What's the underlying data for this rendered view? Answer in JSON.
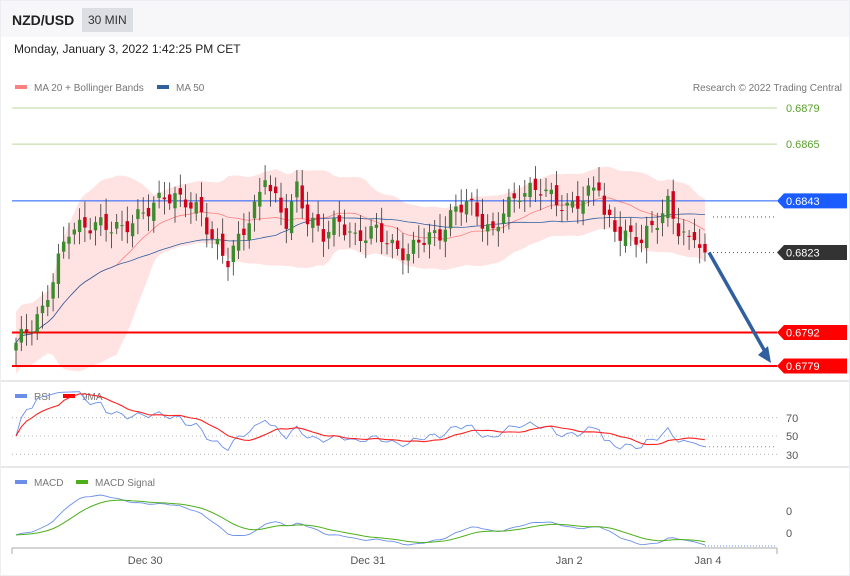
{
  "header": {
    "pair": "NZD/USD",
    "timeframe": "30 MIN",
    "datetime": "Monday, January 3, 2022 1:42:25 PM CET"
  },
  "copyright": "Research © 2022 Trading Central",
  "colors": {
    "up": "#3d8b2f",
    "down": "#d0021b",
    "ma20": "#ff8080",
    "ma50": "#2f5f9e",
    "band": "#ffe3e3",
    "resistance": "#7cb342",
    "pivot": "#1a5cff",
    "current": "#333333",
    "support": "#ff0000",
    "arrow": "#2f5f9e",
    "rsi": "#6b8fe8",
    "rsi_ma": "#ff2020",
    "macd": "#6b8fe8",
    "signal": "#4caf1a"
  },
  "chart_data": [
    {
      "type": "candlestick",
      "title": "NZD/USD 30 MIN",
      "legend": [
        "MA 20 + Bollinger Bands",
        "MA 50"
      ],
      "ylim": [
        0.6779,
        0.6879
      ],
      "x_ticks": [
        {
          "label": "Dec 30",
          "index": 24
        },
        {
          "label": "Dec 31",
          "index": 66
        },
        {
          "label": "Jan 2",
          "index": 104
        },
        {
          "label": "Jan 4",
          "index": 130
        }
      ],
      "close_anchors": [
        [
          0,
          0.6788
        ],
        [
          5,
          0.68
        ],
        [
          8,
          0.682
        ],
        [
          10,
          0.6832
        ],
        [
          16,
          0.6834
        ],
        [
          20,
          0.6832
        ],
        [
          25,
          0.684
        ],
        [
          28,
          0.6845
        ],
        [
          32,
          0.6843
        ],
        [
          35,
          0.6838
        ],
        [
          37,
          0.6828
        ],
        [
          40,
          0.682
        ],
        [
          42,
          0.6828
        ],
        [
          45,
          0.684
        ],
        [
          47,
          0.6851
        ],
        [
          49,
          0.6843
        ],
        [
          51,
          0.6835
        ],
        [
          53,
          0.6848
        ],
        [
          55,
          0.6836
        ],
        [
          58,
          0.683
        ],
        [
          61,
          0.6835
        ],
        [
          64,
          0.6828
        ],
        [
          68,
          0.6832
        ],
        [
          71,
          0.6825
        ],
        [
          74,
          0.6822
        ],
        [
          76,
          0.6828
        ],
        [
          80,
          0.683
        ],
        [
          83,
          0.684
        ],
        [
          85,
          0.6843
        ],
        [
          88,
          0.6835
        ],
        [
          90,
          0.683
        ],
        [
          92,
          0.684
        ],
        [
          95,
          0.6846
        ],
        [
          99,
          0.6848
        ],
        [
          102,
          0.6843
        ],
        [
          104,
          0.684
        ],
        [
          107,
          0.6844
        ],
        [
          110,
          0.685
        ],
        [
          111,
          0.6837
        ],
        [
          114,
          0.683
        ],
        [
          118,
          0.6828
        ],
        [
          122,
          0.6838
        ],
        [
          123,
          0.6842
        ],
        [
          125,
          0.6832
        ],
        [
          127,
          0.6827
        ],
        [
          128,
          0.683
        ],
        [
          130,
          0.6823
        ]
      ],
      "levels": [
        {
          "label": "0.6879",
          "value": 0.6879,
          "kind": "resistance"
        },
        {
          "label": "0.6865",
          "value": 0.6865,
          "kind": "resistance"
        },
        {
          "label": "0.6843",
          "value": 0.6843,
          "kind": "pivot"
        },
        {
          "label": "0.6823",
          "value": 0.6823,
          "kind": "current"
        },
        {
          "label": "0.6792",
          "value": 0.6792,
          "kind": "support"
        },
        {
          "label": "0.6779",
          "value": 0.6779,
          "kind": "support"
        }
      ],
      "forecast_arrow": {
        "from": 0.6823,
        "to": 0.6779
      }
    },
    {
      "type": "line",
      "title": "RSI",
      "legend": [
        "RSI",
        "9MA"
      ],
      "ylim": [
        20,
        80
      ],
      "y_ticks": [
        "70",
        "50",
        "30"
      ],
      "y_values": [
        70,
        50,
        30
      ]
    },
    {
      "type": "line",
      "title": "MACD",
      "legend": [
        "MACD",
        "MACD Signal"
      ],
      "y_ticks": [
        "0",
        "0"
      ]
    }
  ]
}
